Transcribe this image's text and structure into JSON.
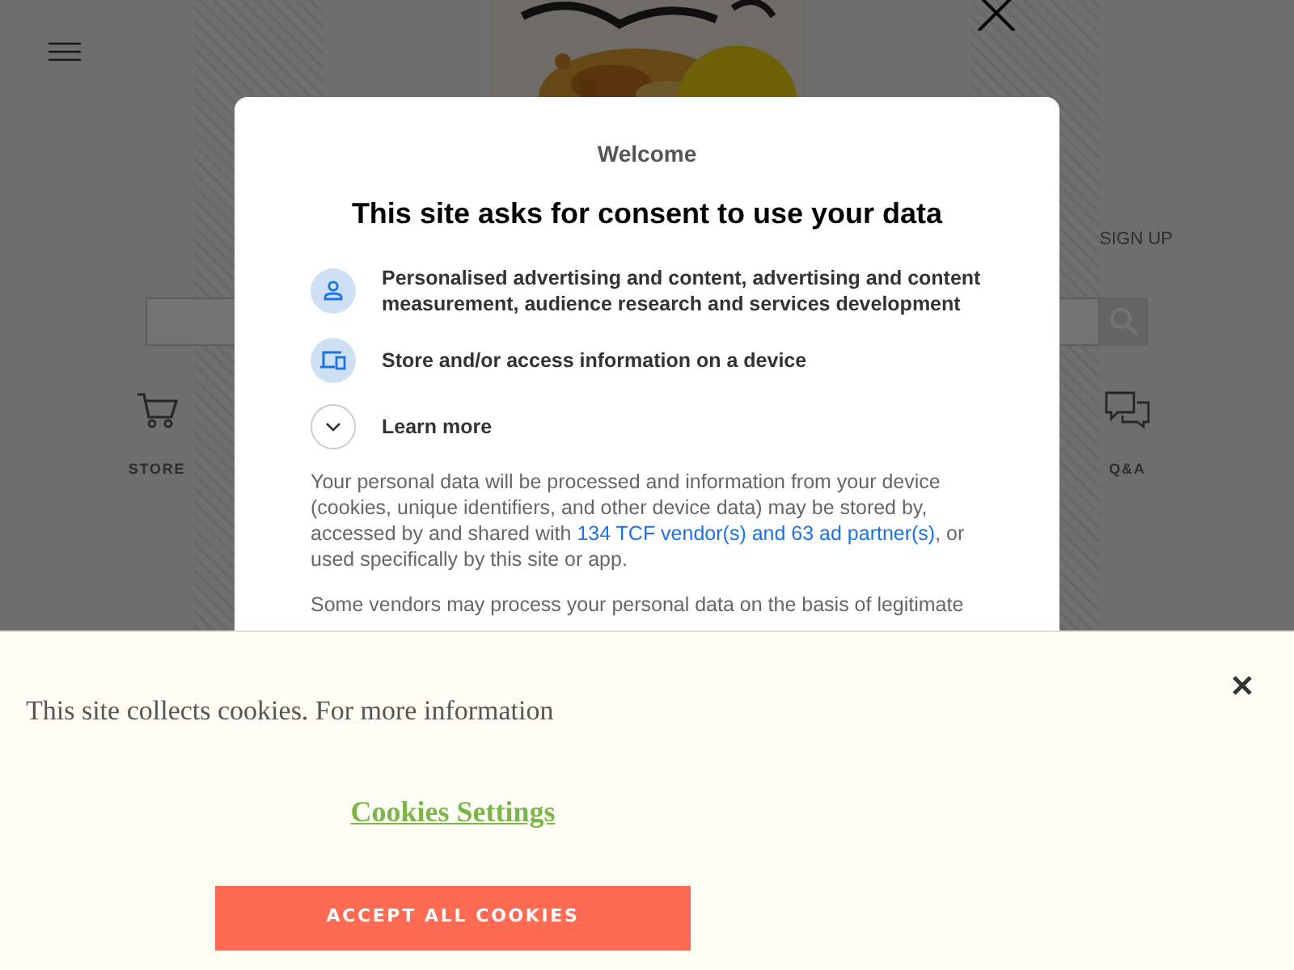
{
  "page": {
    "header": {
      "sign_up": "SIGN UP"
    },
    "nav": [
      {
        "kind": "cart",
        "label": "STORE"
      },
      {
        "kind": "chat",
        "label": "Q&A"
      }
    ]
  },
  "consent_dialog": {
    "subtitle": "Welcome",
    "title": "This site asks for consent to use your data",
    "purposes": [
      {
        "kind": "person",
        "label": "Personalised advertising and content, advertising and content measurement, audience research and services development"
      },
      {
        "kind": "devices",
        "label": "Store and/or access information on a device"
      }
    ],
    "learn_more": {
      "label": "Learn more",
      "expanded": false
    },
    "body": [
      {
        "text_before": "Your personal data will be processed and information from your device (cookies, unique identifiers, and other device data) may be stored by, accessed by and shared with ",
        "link": "134 TCF vendor(s) and 63 ad partner(s)",
        "text_after": ", or used specifically by this site or app."
      },
      {
        "text_before": "Some vendors may process your personal data on the basis of legitimate"
      }
    ]
  },
  "cookie_banner": {
    "message": "This site collects cookies. For more information",
    "settings_link": "Cookies Settings",
    "accept_button": "ACCEPT ALL COOKIES"
  }
}
